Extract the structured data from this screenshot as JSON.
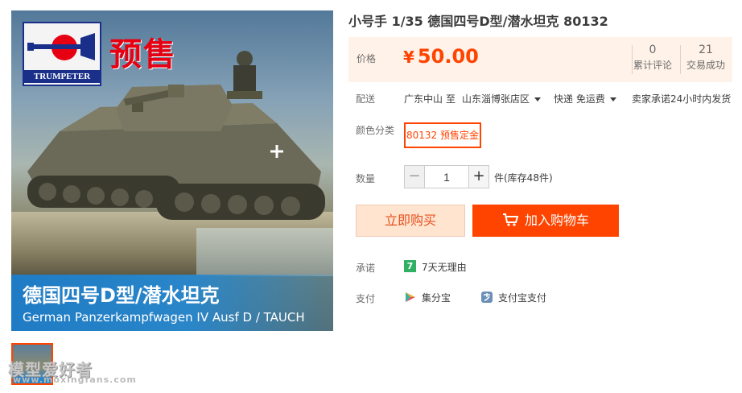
{
  "product": {
    "title": "小号手 1/35 德国四号D型/潜水坦克 80132",
    "image_text": {
      "brand": "TRUMPETER",
      "badge": "预售",
      "banner_cn": "德国四号D型/潜水坦克",
      "banner_en": "German Panzerkampfwagen IV Ausf D / TAUCH"
    }
  },
  "price": {
    "label": "价格",
    "currency": "¥",
    "amount": "50.00",
    "reviews_count": "0",
    "reviews_label": "累计评论",
    "sales_count": "21",
    "sales_label": "交易成功"
  },
  "shipping": {
    "label": "配送",
    "from": "广东中山",
    "to_word": "至",
    "destination": "山东淄博张店区",
    "method": "快递 免运费",
    "promise": "卖家承诺24小时内发货"
  },
  "sku": {
    "label": "颜色分类",
    "selected": "80132 预售定金"
  },
  "quantity": {
    "label": "数量",
    "minus": "−",
    "value": "1",
    "plus": "+",
    "stock_text": "件(库存48件)"
  },
  "actions": {
    "buy_now": "立即购买",
    "add_cart": "加入购物车"
  },
  "promise": {
    "label": "承诺",
    "badge": "7",
    "text": "7天无理由"
  },
  "payment": {
    "label": "支付",
    "methods": [
      "集分宝",
      "支付宝支付"
    ]
  },
  "watermark": {
    "cn": "模型爱好者",
    "url": "www.moxingfans.com"
  },
  "colors": {
    "accent": "#ff4400",
    "price": "#ff4400",
    "price_bg": "#fff2e8",
    "buy_now_bg": "#ffe4d0",
    "promise_green": "#2fb062"
  }
}
